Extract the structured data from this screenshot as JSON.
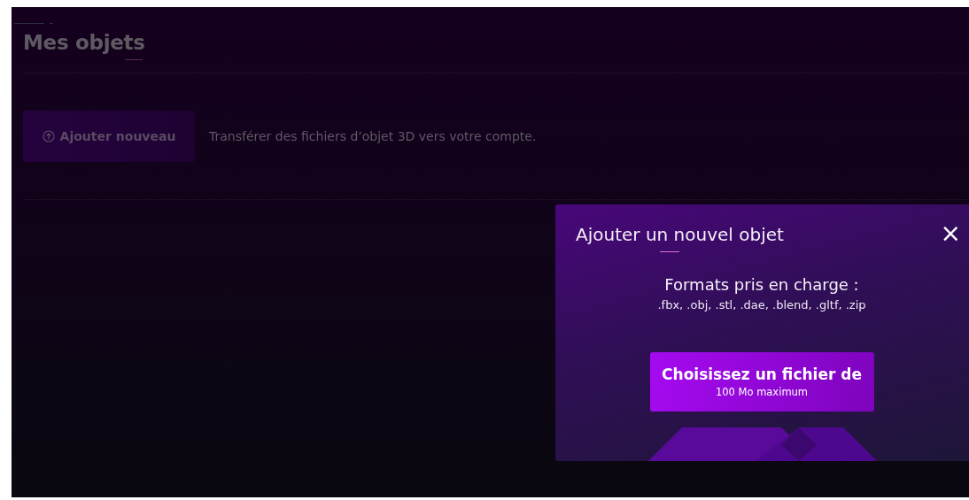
{
  "page": {
    "title": "Mes objets",
    "add_button": {
      "label": "Ajouter nouveau"
    },
    "description": "Transférer des fichiers d’objet 3D vers votre compte."
  },
  "modal": {
    "title": "Ajouter un nouvel objet",
    "close": "×",
    "formats_label": "Formats pris en charge :",
    "formats": ".fbx, .obj, .stl, .dae, .blend, .gltf, .zip",
    "upload_button": {
      "label": "Choisissez un fichier de",
      "sublabel": "100 Mo maximum"
    }
  }
}
